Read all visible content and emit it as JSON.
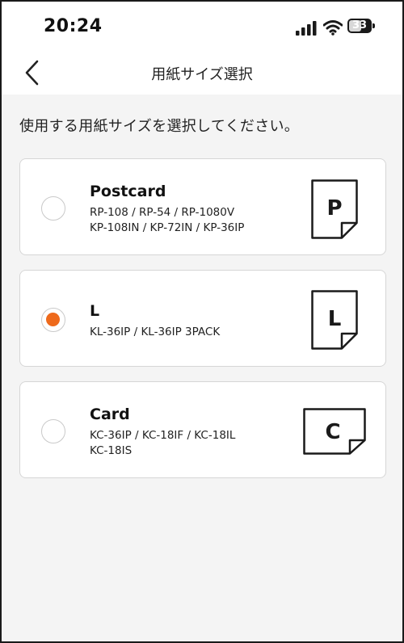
{
  "status_bar": {
    "time": "20:24",
    "battery": "33"
  },
  "header": {
    "title": "用紙サイズ選択"
  },
  "instruction": "使用する用紙サイズを選択してください。",
  "options": [
    {
      "name": "Postcard",
      "models_line1": "RP-108 / RP-54 / RP-1080V",
      "models_line2": "KP-108IN / KP-72IN / KP-36IP",
      "icon_letter": "P",
      "selected": false
    },
    {
      "name": "L",
      "models_line1": "KL-36IP / KL-36IP 3PACK",
      "models_line2": "",
      "icon_letter": "L",
      "selected": true
    },
    {
      "name": "Card",
      "models_line1": "KC-36IP / KC-18IF / KC-18IL",
      "models_line2": "KC-18IS",
      "icon_letter": "C",
      "selected": false
    }
  ],
  "colors": {
    "accent": "#ee6a1c",
    "background": "#f4f4f4"
  },
  "icons": [
    "signal-icon",
    "wifi-icon",
    "battery-icon",
    "back-chevron-icon",
    "paper-icon"
  ]
}
